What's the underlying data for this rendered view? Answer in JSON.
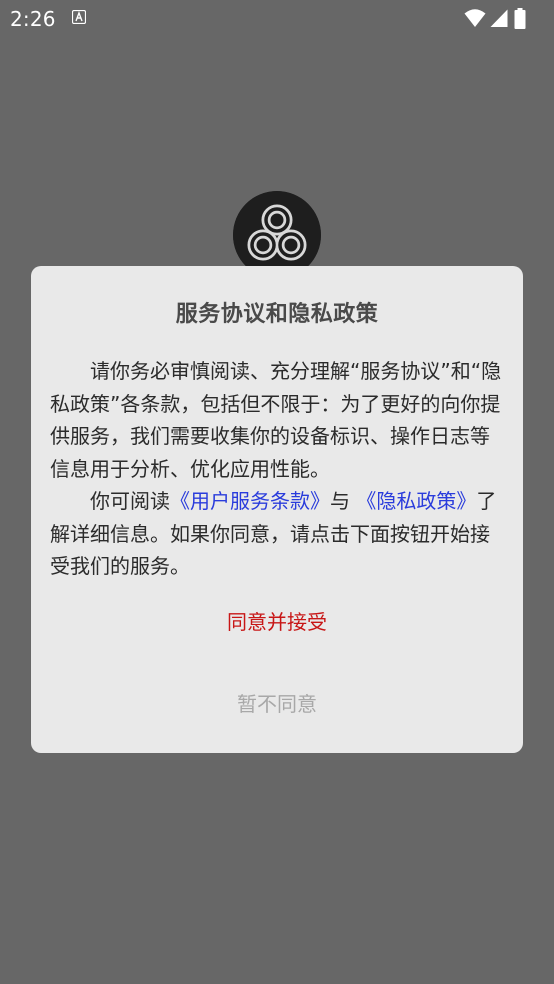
{
  "status_bar": {
    "time": "2:26",
    "notification_icon": "text-icon",
    "wifi_icon": "wifi-icon",
    "signal_icon": "cell-signal-icon",
    "battery_icon": "battery-icon"
  },
  "app": {
    "logo_icon": "triangle-knot-logo"
  },
  "dialog": {
    "title": "服务协议和隐私政策",
    "paragraph1": "请你务必审慎阅读、充分理解“服务协议”和“隐私政策”各条款，包括但不限于：为了更好的向你提供服务，我们需要收集你的设备标识、操作日志等信息用于分析、优化应用性能。",
    "paragraph2_prefix": "你可阅读",
    "user_terms_link": "《用户服务条款》",
    "paragraph2_and": "与",
    "privacy_link": "《隐私政策》",
    "paragraph2_suffix": "了解详细信息。如果你同意，请点击下面按钮开始接受我们的服务。",
    "accept_label": "同意并接受",
    "decline_label": "暂不同意"
  },
  "colors": {
    "backdrop": "#676767",
    "dialog_bg": "#e9e9e9",
    "accept": "#c81616",
    "decline": "#a8a8a8",
    "link": "#2a3cdc",
    "title": "#4a4a4a"
  }
}
